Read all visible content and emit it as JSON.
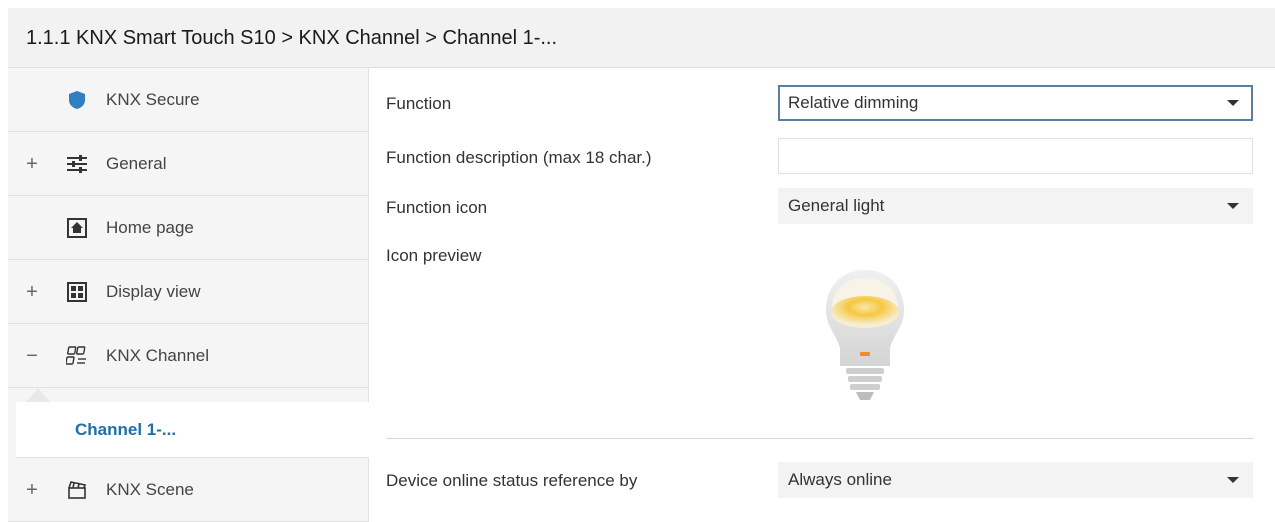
{
  "breadcrumb": {
    "text": "1.1.1 KNX Smart Touch S10 > KNX Channel  > Channel 1-..."
  },
  "sidebar": {
    "items": [
      {
        "label": "KNX Secure",
        "toggle": "",
        "icon": "shield-icon"
      },
      {
        "label": "General",
        "toggle": "+",
        "icon": "sliders-icon"
      },
      {
        "label": "Home page",
        "toggle": "",
        "icon": "home-icon"
      },
      {
        "label": "Display view",
        "toggle": "+",
        "icon": "grid-view-icon"
      },
      {
        "label": "KNX Channel",
        "toggle": "−",
        "icon": "channel-icon"
      },
      {
        "label": "KNX Scene",
        "toggle": "+",
        "icon": "clapperboard-icon"
      }
    ],
    "selected_child": {
      "label": "Channel 1-..."
    }
  },
  "form": {
    "function": {
      "label": "Function",
      "value": "Relative dimming"
    },
    "description": {
      "label": "Function description (max 18 char.)",
      "value": ""
    },
    "icon": {
      "label": "Function icon",
      "value": "General light"
    },
    "preview": {
      "label": "Icon preview",
      "icon": "light-bulb-icon"
    },
    "online_status": {
      "label": "Device online status reference by",
      "value": "Always online"
    }
  },
  "colors": {
    "accent": "#1f6fa8",
    "shield": "#2f7fc1",
    "bulb_glow": "#f5c842",
    "bulb_indicator": "#f08a2c",
    "active_border": "#5a7da3"
  }
}
